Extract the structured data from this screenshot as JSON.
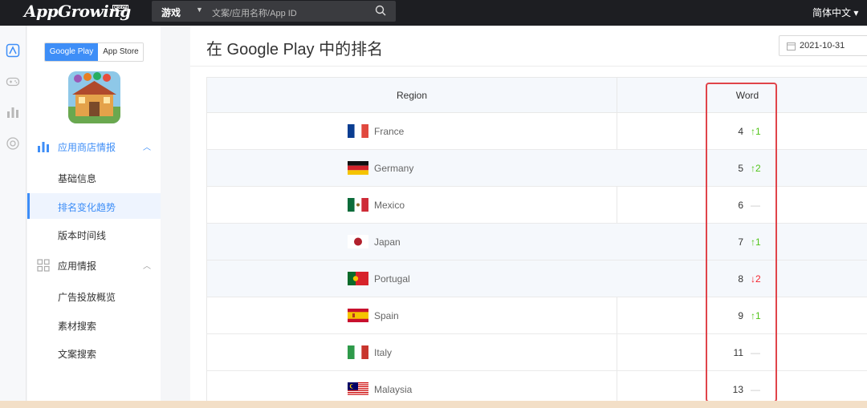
{
  "topbar": {
    "logo_text": "AppGrowing",
    "logo_badge": "Global",
    "category": "游戏",
    "search_placeholder": "文案/应用名称/App ID",
    "language": "简体中文 ▾"
  },
  "sidebar": {
    "store_tabs": [
      {
        "label": "Google Play",
        "active": true
      },
      {
        "label": "App Store",
        "active": false
      }
    ],
    "sections": [
      {
        "label": "应用商店情报",
        "icon": "bar-chart-icon",
        "expanded": true,
        "items": [
          {
            "label": "基础信息",
            "active": false
          },
          {
            "label": "排名变化趋势",
            "active": true
          },
          {
            "label": "版本时间线",
            "active": false
          }
        ]
      },
      {
        "label": "应用情报",
        "icon": "grid-icon",
        "expanded": true,
        "items": [
          {
            "label": "广告投放概览",
            "active": false
          },
          {
            "label": "素材搜索",
            "active": false
          },
          {
            "label": "文案搜索",
            "active": false
          }
        ]
      }
    ]
  },
  "main": {
    "title": "在 Google Play 中的排名",
    "date": "2021-10-31",
    "table": {
      "columns": [
        "Region",
        "Word"
      ],
      "rows": [
        {
          "country": "France",
          "rank": "4",
          "delta": "↑1",
          "trend": "up"
        },
        {
          "country": "Germany",
          "rank": "5",
          "delta": "↑2",
          "trend": "up"
        },
        {
          "country": "Mexico",
          "rank": "6",
          "delta": "—",
          "trend": "flat"
        },
        {
          "country": "Japan",
          "rank": "7",
          "delta": "↑1",
          "trend": "up"
        },
        {
          "country": "Portugal",
          "rank": "8",
          "delta": "↓2",
          "trend": "down"
        },
        {
          "country": "Spain",
          "rank": "9",
          "delta": "↑1",
          "trend": "up"
        },
        {
          "country": "Italy",
          "rank": "11",
          "delta": "—",
          "trend": "flat"
        },
        {
          "country": "Malaysia",
          "rank": "13",
          "delta": "—",
          "trend": "flat"
        }
      ]
    }
  },
  "colors": {
    "accent": "#3e8ef7",
    "up": "#52c41a",
    "down": "#f5222d",
    "highlight": "#e0444a"
  }
}
